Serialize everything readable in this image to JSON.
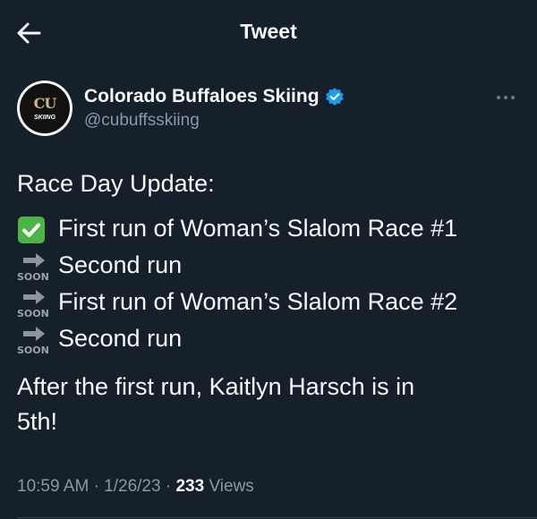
{
  "header": {
    "title": "Tweet"
  },
  "author": {
    "display_name": "Colorado Buffaloes Skiing",
    "handle": "@cubuffsskiing",
    "avatar_monogram": "CU",
    "avatar_text": "SKIING",
    "verified": true
  },
  "tweet": {
    "intro": "Race Day Update:",
    "items": [
      {
        "icon": "check-mark-icon",
        "text": "First run of Woman’s Slalom Race #1"
      },
      {
        "icon": "soon-arrow-icon",
        "icon_label": "SOON",
        "text": "Second run"
      },
      {
        "icon": "soon-arrow-icon",
        "icon_label": "SOON",
        "text": "First run of Woman’s Slalom Race #2"
      },
      {
        "icon": "soon-arrow-icon",
        "icon_label": "SOON",
        "text": "Second run"
      }
    ],
    "closing_line1": "After the first run, Kaitlyn Harsch is in",
    "closing_line2": "5th!"
  },
  "meta": {
    "time": "10:59 AM",
    "date": "1/26/23",
    "views_count": "233",
    "views_label": "Views",
    "separator": "·"
  },
  "colors": {
    "background": "#15202b",
    "text": "#f7f9f9",
    "secondary_text": "#8b98a5",
    "verified_badge": "#1d9bf0",
    "check_green": "#4bb543"
  }
}
